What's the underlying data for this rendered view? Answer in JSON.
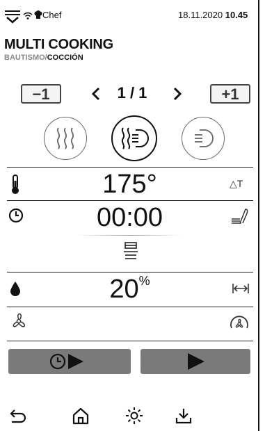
{
  "status": {
    "user": "Chef",
    "date": "18.11.2020",
    "time": "10.45"
  },
  "header": {
    "title": "MULTI COOKING",
    "sub_prefix": "BAUTISMO/",
    "sub_current": "COCCIÓN"
  },
  "pager": {
    "minus_label": "−1",
    "plus_label": "+1",
    "page": "1 / 1",
    "prev_glyph": "<",
    "next_glyph": ">"
  },
  "params": {
    "temperature": "175°",
    "temp_mode_label": "△T",
    "timer": "00:00",
    "humidity": "20",
    "humidity_unit": "%"
  },
  "modes": [
    "steam-mode",
    "combi-mode",
    "convection-mode"
  ],
  "colors": {
    "button_bg": "#7a7a7a",
    "ink": "#111111"
  }
}
